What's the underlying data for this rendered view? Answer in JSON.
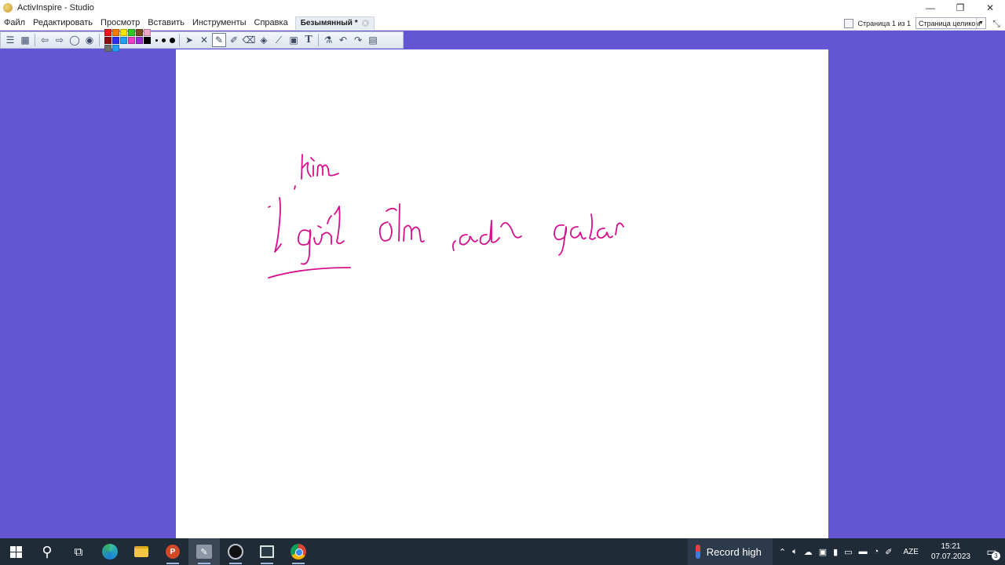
{
  "window": {
    "title": "ActivInspire - Studio",
    "controls": {
      "minimize": "—",
      "restore": "❐",
      "close": "✕"
    }
  },
  "menu": {
    "items": [
      "Файл",
      "Редактировать",
      "Просмотр",
      "Вставить",
      "Инструменты",
      "Справка"
    ],
    "doc_tab": "Безымянный *",
    "page_indicator": "Страница 1 из 1",
    "zoom_value": "Страница целиком"
  },
  "toolbar": {
    "palette": [
      "#e81818",
      "#f27a00",
      "#f5e400",
      "#2cc52c",
      "#7a4a1c",
      "#f2a6c8",
      "#8a0f0f",
      "#2d2df2",
      "#1fa0f5",
      "#f23ac8",
      "#9a2bd6",
      "#000000",
      "#6f6f6f",
      "#1fa0f5"
    ]
  },
  "canvas": {
    "ink_color": "#d60f8c",
    "background": "#ffffff",
    "workspace": "#6455d3"
  },
  "taskbar": {
    "weather": "Record high",
    "language": "AZE",
    "time": "15:21",
    "date": "07.07.2023",
    "notifications": "3"
  }
}
